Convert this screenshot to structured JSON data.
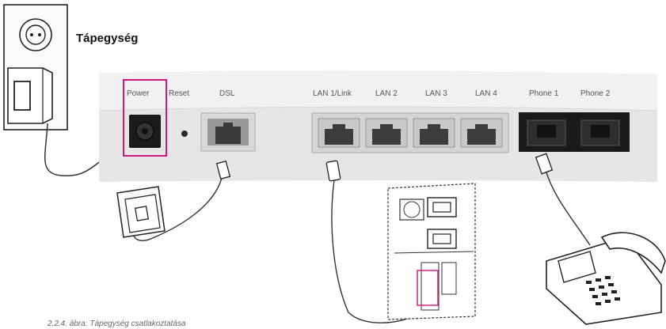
{
  "title": "Tápegység",
  "ports": {
    "power": "Power",
    "reset": "Reset",
    "dsl": "DSL",
    "lan1": "LAN 1/Link",
    "lan2": "LAN 2",
    "lan3": "LAN 3",
    "lan4": "LAN 4",
    "phone1": "Phone 1",
    "phone2": "Phone 2"
  },
  "caption": "2.2.4. ábra: Tápegység csatlakoztatása",
  "colors": {
    "highlight": "#d4157a",
    "panel": "#e9e9e9",
    "panel_edge": "#c9c9c9"
  }
}
